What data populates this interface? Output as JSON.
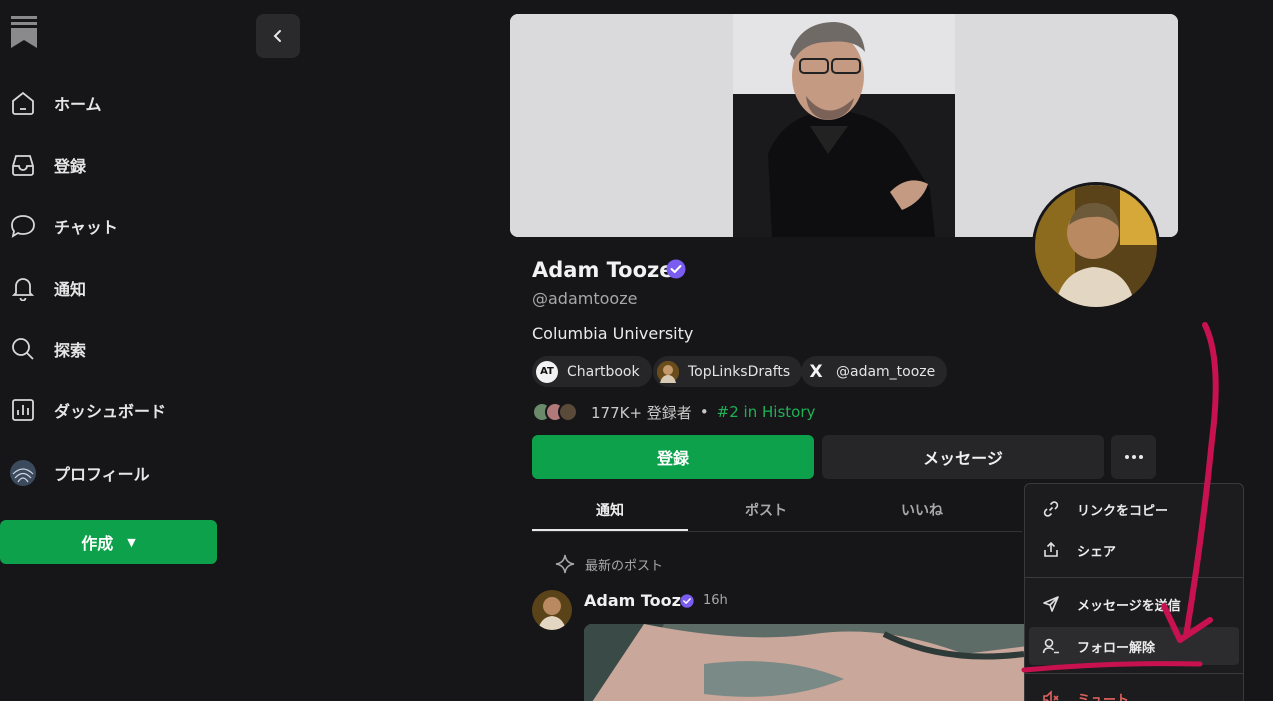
{
  "sidebar": {
    "items": [
      {
        "label": "ホーム",
        "icon": "home-icon"
      },
      {
        "label": "登録",
        "icon": "inbox-icon"
      },
      {
        "label": "チャット",
        "icon": "chat-icon"
      },
      {
        "label": "通知",
        "icon": "bell-icon"
      },
      {
        "label": "探索",
        "icon": "search-icon"
      },
      {
        "label": "ダッシュボード",
        "icon": "dashboard-icon"
      },
      {
        "label": "プロフィール",
        "icon": "profile-avatar"
      }
    ],
    "create_label": "作成"
  },
  "profile": {
    "name": "Adam Tooze",
    "handle": "@adamtooze",
    "bio": "Columbia University",
    "chips": [
      {
        "label": "Chartbook",
        "icon_text": "AT"
      },
      {
        "label": "TopLinksDrafts",
        "icon_text": ""
      },
      {
        "label": "@adam_tooze",
        "icon_text": "X"
      }
    ],
    "subscribers": "177K+ 登録者",
    "separator": "•",
    "rank": "#2 in History",
    "subscribe_label": "登録",
    "message_label": "メッセージ"
  },
  "tabs": [
    {
      "label": "通知",
      "active": true
    },
    {
      "label": "ポスト",
      "active": false
    },
    {
      "label": "いいね",
      "active": false
    }
  ],
  "latest_label": "最新のポスト",
  "post": {
    "author": "Adam Tooze",
    "time": "16h"
  },
  "menu": {
    "items": [
      {
        "label": "リンクをコピー",
        "icon": "link-icon"
      },
      {
        "label": "シェア",
        "icon": "share-icon"
      },
      {
        "label": "メッセージを送信",
        "icon": "send-icon"
      },
      {
        "label": "フォロー解除",
        "icon": "unfollow-icon"
      },
      {
        "label": "ミュート",
        "icon": "mute-icon"
      }
    ]
  },
  "colors": {
    "accent": "#0ea14b",
    "verified": "#7b5cf0",
    "annotation": "#c8124f",
    "rank": "#1fb156"
  }
}
